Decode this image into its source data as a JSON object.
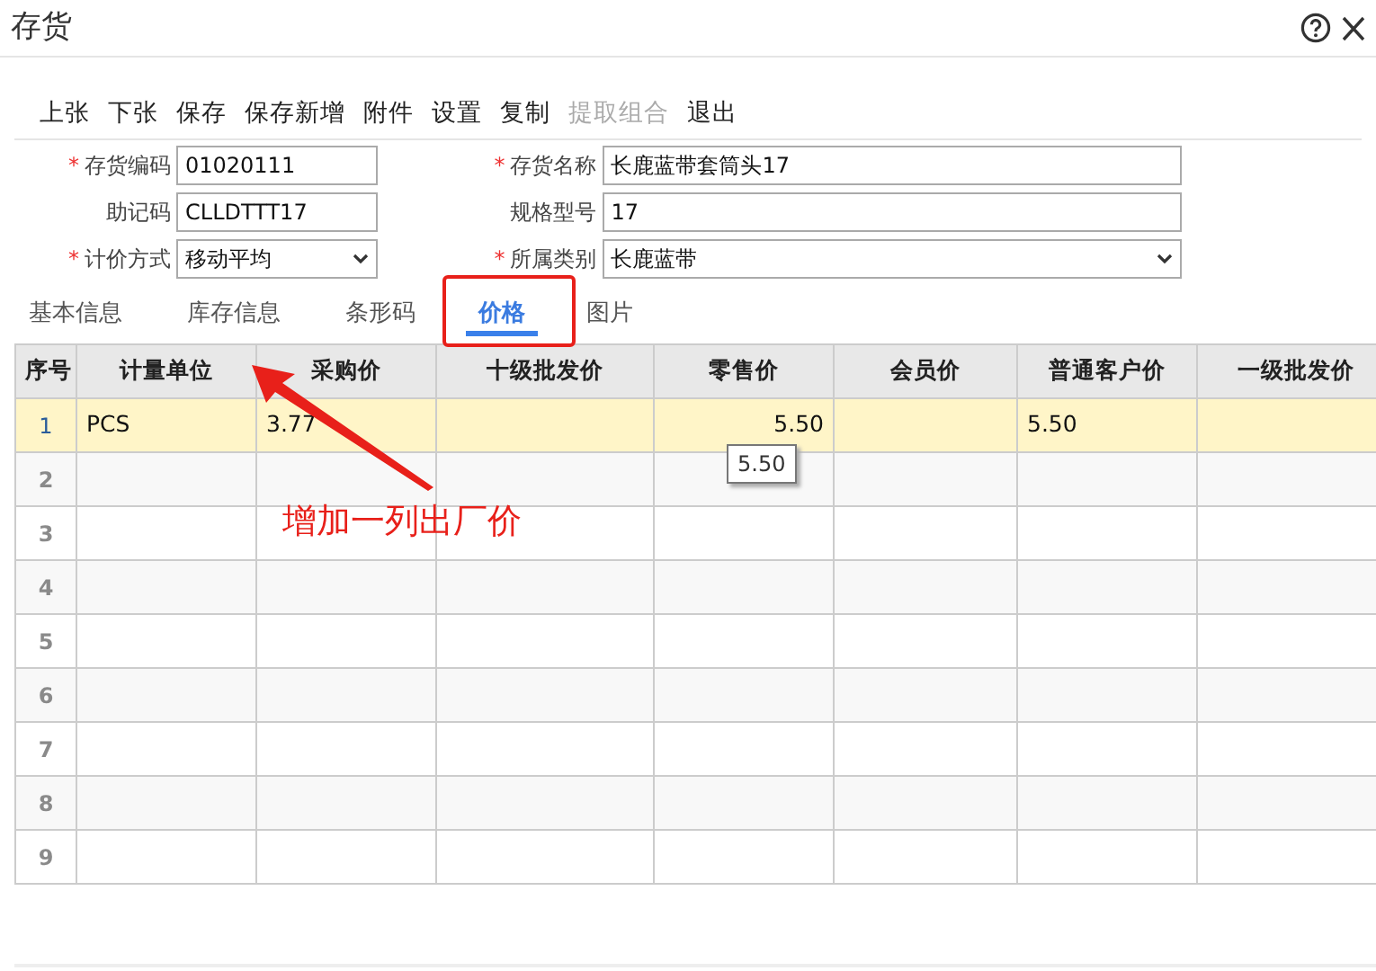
{
  "window": {
    "title": "存货"
  },
  "toolbar": [
    {
      "label": "上张",
      "disabled": false
    },
    {
      "label": "下张",
      "disabled": false
    },
    {
      "label": "保存",
      "disabled": false
    },
    {
      "label": "保存新增",
      "disabled": false
    },
    {
      "label": "附件",
      "disabled": false
    },
    {
      "label": "设置",
      "disabled": false
    },
    {
      "label": "复制",
      "disabled": false
    },
    {
      "label": "提取组合",
      "disabled": true
    },
    {
      "label": "退出",
      "disabled": false
    }
  ],
  "form": {
    "fields": [
      {
        "label": "存货编码",
        "required_mark": "*",
        "kind": "text",
        "value": "01020111"
      },
      {
        "label": "存货名称",
        "required_mark": "*",
        "kind": "text",
        "value": "长鹿蓝带套筒头17"
      },
      {
        "label": "助记码",
        "kind": "text",
        "value": "CLLDTTT17"
      },
      {
        "label": "规格型号",
        "kind": "text",
        "value": "17"
      },
      {
        "label": "计价方式",
        "required_mark": "*",
        "kind": "select",
        "value": "移动平均"
      },
      {
        "label": "所属类别",
        "required_mark": "*",
        "kind": "select",
        "value": "长鹿蓝带"
      }
    ]
  },
  "tabs": [
    {
      "label": "基本信息",
      "selected": false
    },
    {
      "label": "库存信息",
      "selected": false
    },
    {
      "label": "条形码",
      "selected": false
    },
    {
      "label": "价格",
      "selected": true
    },
    {
      "label": "图片",
      "selected": false
    }
  ],
  "table": {
    "columns": [
      "序号",
      "计量单位",
      "采购价",
      "十级批发价",
      "零售价",
      "会员价",
      "普通客户价",
      "一级批发价"
    ],
    "rows": [
      {
        "number": "1",
        "selected": true,
        "unit": "PCS",
        "purchase_price": "3.77",
        "retail_price": "5.50",
        "regular_customer_price": "5.50"
      },
      {
        "number": "2",
        "selected": false
      },
      {
        "number": "3",
        "selected": false
      },
      {
        "number": "4",
        "selected": false
      },
      {
        "number": "5",
        "selected": false
      },
      {
        "number": "6",
        "selected": false
      },
      {
        "number": "7",
        "selected": false
      },
      {
        "number": "8",
        "selected": false
      },
      {
        "number": "9",
        "selected": false
      }
    ]
  },
  "tooltip": {
    "text": "5.50"
  },
  "annotation": {
    "text": "增加一列出厂价"
  }
}
